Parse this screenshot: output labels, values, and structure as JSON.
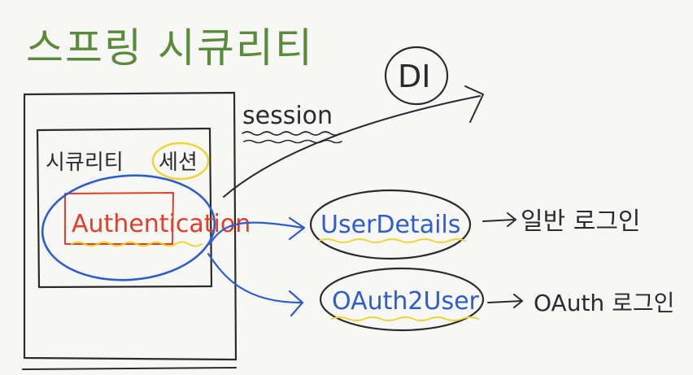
{
  "title": "스프링 시큐리티",
  "labels": {
    "security": "시큐리티",
    "session_kr": "세션",
    "authentication": "Authentication",
    "session_en": "session",
    "di": "DI",
    "user_details": "UserDetails",
    "oauth2_user": "OAuth2User",
    "normal_login": "일반 로그인",
    "oauth_login": "OAuth 로그인"
  },
  "colors": {
    "black": "#2b2b2b",
    "green": "#5a8a3a",
    "blue": "#2f5ec9",
    "red": "#e0402a",
    "yellow": "#f0d43a"
  }
}
